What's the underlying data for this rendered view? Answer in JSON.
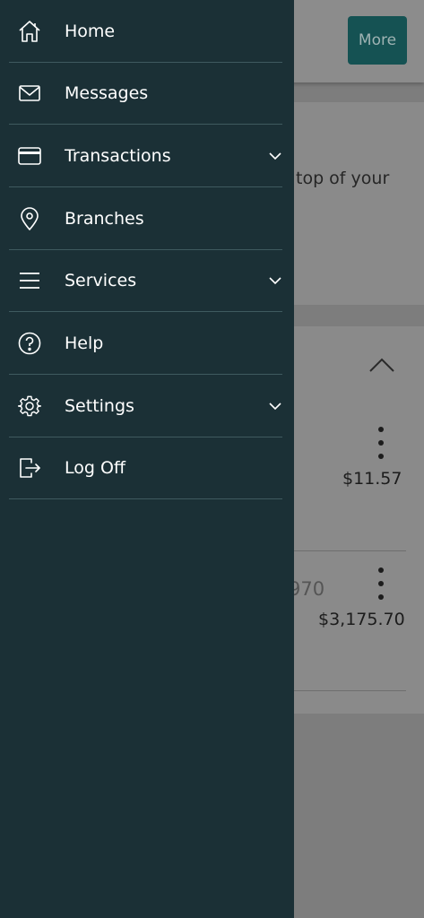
{
  "background": {
    "more_label": "More",
    "notice_text": "top of your",
    "account_1": {
      "amount": "$11.57"
    },
    "account_2": {
      "digits": "970",
      "amount": "$3,175.70"
    }
  },
  "menu": {
    "items": [
      {
        "label": "Home",
        "icon": "home-icon",
        "has_chevron": false
      },
      {
        "label": "Messages",
        "icon": "envelope-icon",
        "has_chevron": false
      },
      {
        "label": "Transactions",
        "icon": "credit-card-icon",
        "has_chevron": true
      },
      {
        "label": "Branches",
        "icon": "map-pin-icon",
        "has_chevron": false
      },
      {
        "label": "Services",
        "icon": "menu-lines-icon",
        "has_chevron": true
      },
      {
        "label": "Help",
        "icon": "help-circle-icon",
        "has_chevron": false
      },
      {
        "label": "Settings",
        "icon": "gear-icon",
        "has_chevron": true
      },
      {
        "label": "Log Off",
        "icon": "log-off-icon",
        "has_chevron": false
      }
    ]
  },
  "colors": {
    "drawer_bg": "#1b3036",
    "drawer_divider": "#3f5a5f",
    "accent_button": "#155253",
    "overlay_bg": "#7d7d7d"
  }
}
